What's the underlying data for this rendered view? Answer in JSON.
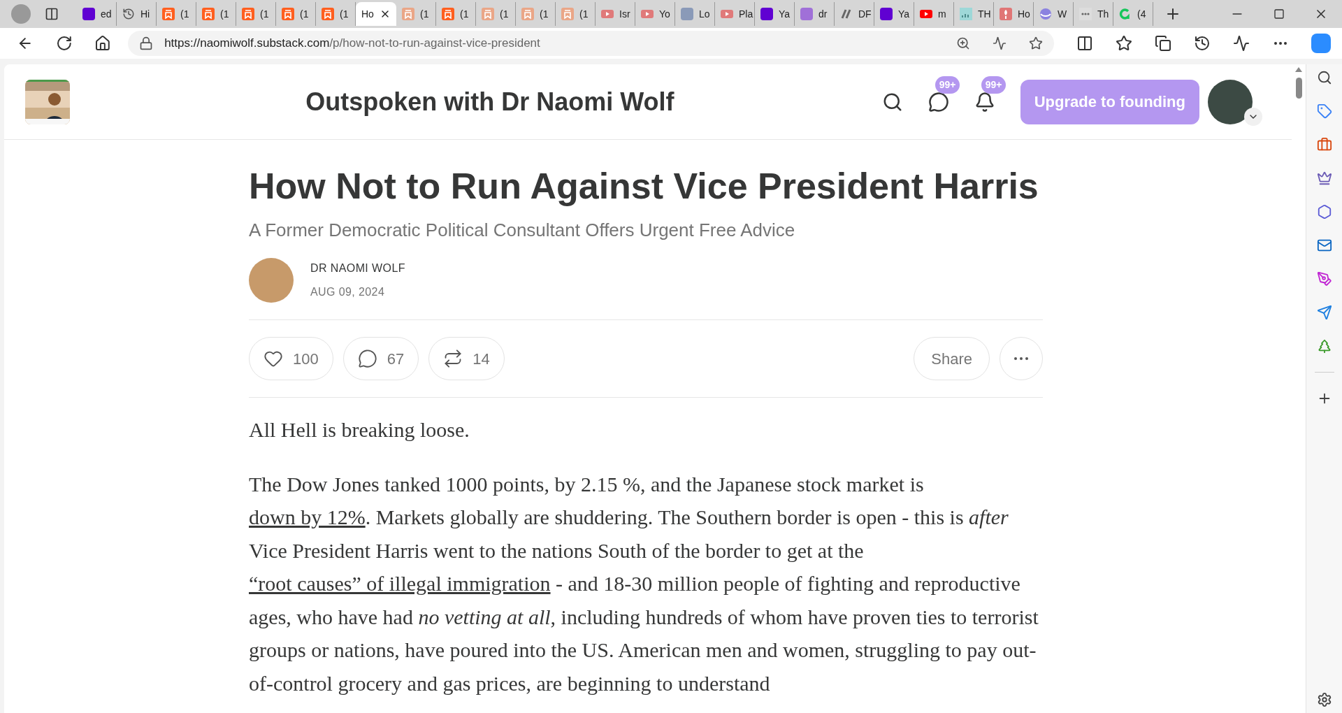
{
  "browser": {
    "tabs": [
      {
        "label": "ed",
        "kind": "yahoo",
        "selected": false
      },
      {
        "label": "Hi",
        "kind": "history",
        "selected": false
      },
      {
        "label": "(1",
        "kind": "substack",
        "selected": false
      },
      {
        "label": "(1",
        "kind": "substack",
        "selected": false
      },
      {
        "label": "(1",
        "kind": "substack",
        "selected": false
      },
      {
        "label": "(1",
        "kind": "substack",
        "selected": false
      },
      {
        "label": "(1",
        "kind": "substack",
        "selected": false
      },
      {
        "label": "Ho",
        "kind": "none",
        "selected": true
      },
      {
        "label": "(1",
        "kind": "substack_faded",
        "selected": false
      },
      {
        "label": "(1",
        "kind": "substack",
        "selected": false
      },
      {
        "label": "(1",
        "kind": "substack_faded",
        "selected": false
      },
      {
        "label": "(1",
        "kind": "substack_faded",
        "selected": false
      },
      {
        "label": "(1",
        "kind": "substack_faded",
        "selected": false
      },
      {
        "label": "Isr",
        "kind": "youtube_faded",
        "selected": false
      },
      {
        "label": "Yo",
        "kind": "youtube_faded",
        "selected": false
      },
      {
        "label": "Lo",
        "kind": "tile",
        "selected": false
      },
      {
        "label": "Pla",
        "kind": "youtube_faded",
        "selected": false
      },
      {
        "label": "Ya",
        "kind": "yahoo",
        "selected": false
      },
      {
        "label": "dr",
        "kind": "yahoo_faded",
        "selected": false
      },
      {
        "label": "DF",
        "kind": "slashes",
        "selected": false
      },
      {
        "label": "Ya",
        "kind": "yahoo",
        "selected": false
      },
      {
        "label": "m",
        "kind": "youtube",
        "selected": false
      },
      {
        "label": "TH",
        "kind": "chart",
        "selected": false
      },
      {
        "label": "Ho",
        "kind": "flame",
        "selected": false
      },
      {
        "label": "W",
        "kind": "globe",
        "selected": false
      },
      {
        "label": "Th",
        "kind": "dots",
        "selected": false
      },
      {
        "label": "(4",
        "kind": "grammarly",
        "selected": false
      }
    ],
    "url": {
      "host": "https://naomiwolf.substack.com",
      "path": "/p/how-not-to-run-against-vice-president"
    }
  },
  "header": {
    "title": "Outspoken with Dr Naomi Wolf",
    "badges": [
      "99+",
      "99+"
    ],
    "upgrade_button": "Upgrade to founding"
  },
  "article": {
    "title": "How Not to Run Against Vice President Harris",
    "subtitle": "A Former Democratic Political Consultant Offers Urgent Free Advice",
    "author": "DR NAOMI WOLF",
    "date": "AUG 09, 2024",
    "actions": [
      {
        "kind": "like",
        "count": "100"
      },
      {
        "kind": "comment",
        "count": "67"
      },
      {
        "kind": "restack",
        "count": "14"
      }
    ],
    "share": "Share",
    "paragraphs": [
      [
        {
          "kind": "text",
          "text": "All Hell is breaking loose."
        }
      ],
      [
        {
          "kind": "text",
          "text": "The Dow Jones tanked 1000 points, by 2.15 %, and the Japanese stock market is "
        },
        {
          "kind": "link",
          "text": "down by 12%"
        },
        {
          "kind": "text",
          "text": ". Markets globally are shuddering. The Southern border is open - this is *after* Vice President Harris went to the nations South of the border to get at the "
        },
        {
          "kind": "link",
          "text": "“root causes” of illegal immigration"
        },
        {
          "kind": "text",
          "text": " - and 18-30 million people of fighting and reproductive ages, who have had *no vetting at all*, including hundreds of whom have proven ties to terrorist groups or nations, have poured into the US. American men and women, struggling to pay out-of-control grocery and gas prices, are beginning to understand"
        }
      ]
    ]
  }
}
